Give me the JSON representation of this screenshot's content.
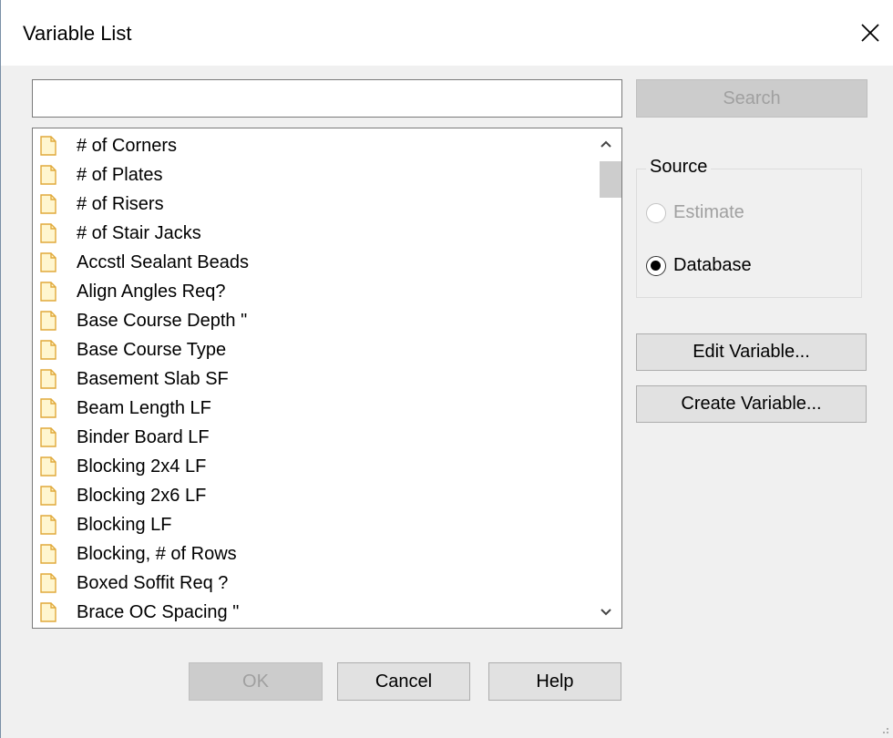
{
  "window": {
    "title": "Variable List"
  },
  "search": {
    "value": "",
    "placeholder": "",
    "button_label": "Search"
  },
  "list": {
    "items": [
      "# of Corners",
      "# of Plates",
      "# of Risers",
      "# of Stair Jacks",
      "Accstl Sealant Beads",
      "Align Angles Req?",
      "Base Course Depth \"",
      "Base Course Type",
      "Basement Slab SF",
      "Beam Length LF",
      "Binder Board LF",
      "Blocking 2x4 LF",
      "Blocking 2x6 LF",
      "Blocking LF",
      "Blocking, # of Rows",
      "Boxed Soffit Req ?",
      "Brace OC Spacing \""
    ],
    "item_icon": "document-icon"
  },
  "source": {
    "label": "Source",
    "options": [
      {
        "label": "Estimate",
        "enabled": false,
        "selected": false
      },
      {
        "label": "Database",
        "enabled": true,
        "selected": true
      }
    ]
  },
  "actions": {
    "edit_label": "Edit Variable...",
    "create_label": "Create Variable..."
  },
  "footer": {
    "ok_label": "OK",
    "cancel_label": "Cancel",
    "help_label": "Help"
  },
  "colors": {
    "icon_fill": "#fff6cf",
    "icon_stroke": "#e0a93a",
    "disabled_text": "#a0a0a0"
  }
}
